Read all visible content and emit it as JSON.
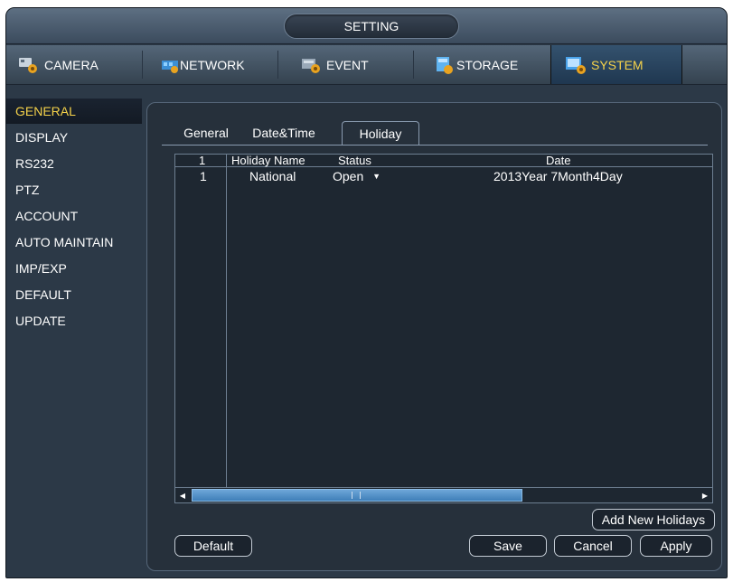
{
  "window": {
    "title": "SETTING"
  },
  "main_tabs": [
    {
      "label": "CAMERA",
      "icon": "camera-settings-icon"
    },
    {
      "label": "NETWORK",
      "icon": "network-icon"
    },
    {
      "label": "EVENT",
      "icon": "event-icon"
    },
    {
      "label": "STORAGE",
      "icon": "storage-icon"
    },
    {
      "label": "SYSTEM",
      "icon": "system-icon",
      "active": true
    }
  ],
  "sidebar": {
    "items": [
      {
        "label": "GENERAL",
        "active": true
      },
      {
        "label": "DISPLAY"
      },
      {
        "label": "RS232"
      },
      {
        "label": "PTZ"
      },
      {
        "label": "ACCOUNT"
      },
      {
        "label": "AUTO MAINTAIN"
      },
      {
        "label": "IMP/EXP"
      },
      {
        "label": "DEFAULT"
      },
      {
        "label": "UPDATE"
      }
    ]
  },
  "sub_tabs": [
    {
      "label": "General"
    },
    {
      "label": "Date&Time"
    },
    {
      "label": "Holiday",
      "active": true
    }
  ],
  "holiday_table": {
    "columns": [
      "1",
      "Holiday Name",
      "Status",
      "Date"
    ],
    "rows": [
      {
        "index": "1",
        "name": "National",
        "status": "Open",
        "date": "2013Year 7Month4Day"
      }
    ]
  },
  "buttons": {
    "add_new_holidays": "Add New Holidays",
    "default": "Default",
    "save": "Save",
    "cancel": "Cancel",
    "apply": "Apply"
  },
  "colors": {
    "active_text": "#f5d24a",
    "background": "#2c3947",
    "scroll_thumb": "#4f8fc8"
  }
}
